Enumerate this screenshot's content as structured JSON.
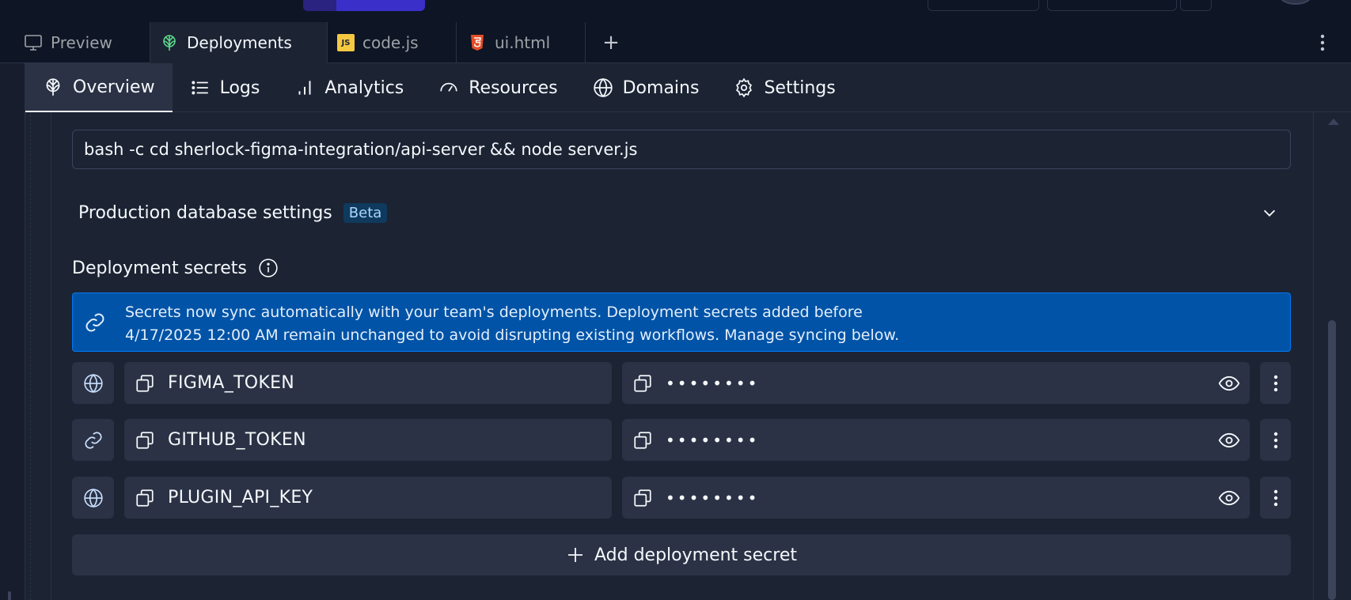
{
  "colors": {
    "background": "#1c2333",
    "tabbar": "#0e1525",
    "surface": "#2b3245",
    "banner": "#0053a6",
    "accent_green": "#5bd88a",
    "js_yellow": "#f5c842",
    "html_orange": "#e44d26"
  },
  "tabs": [
    {
      "label": "Preview",
      "icon": "monitor-icon",
      "active": false
    },
    {
      "label": "Deployments",
      "icon": "deployments-icon",
      "active": true
    },
    {
      "label": "code.js",
      "icon": "js-file-icon",
      "active": false
    },
    {
      "label": "ui.html",
      "icon": "html5-file-icon",
      "active": false
    }
  ],
  "tab_add_label": "+",
  "subnav": [
    {
      "label": "Overview",
      "icon": "deployments-icon",
      "active": true
    },
    {
      "label": "Logs",
      "icon": "list-icon",
      "active": false
    },
    {
      "label": "Analytics",
      "icon": "bar-chart-icon",
      "active": false
    },
    {
      "label": "Resources",
      "icon": "gauge-icon",
      "active": false
    },
    {
      "label": "Domains",
      "icon": "globe-icon",
      "active": false
    },
    {
      "label": "Settings",
      "icon": "gear-icon",
      "active": false
    }
  ],
  "run_command": {
    "value": "bash -c cd sherlock-figma-integration/api-server && node server.js"
  },
  "database_settings": {
    "label": "Production database settings",
    "badge": "Beta"
  },
  "secrets": {
    "title": "Deployment secrets",
    "banner_line1": "Secrets now sync automatically with your team's deployments. Deployment secrets added before",
    "banner_line2": "4/17/2025 12:00 AM remain unchanged to avoid disrupting existing workflows. Manage syncing below.",
    "items": [
      {
        "key": "FIGMA_TOKEN",
        "value_masked": "••••••••",
        "scope_icon": "globe-icon"
      },
      {
        "key": "GITHUB_TOKEN",
        "value_masked": "••••••••",
        "scope_icon": "link-icon"
      },
      {
        "key": "PLUGIN_API_KEY",
        "value_masked": "••••••••",
        "scope_icon": "globe-icon"
      }
    ],
    "add_label": "Add deployment secret"
  }
}
